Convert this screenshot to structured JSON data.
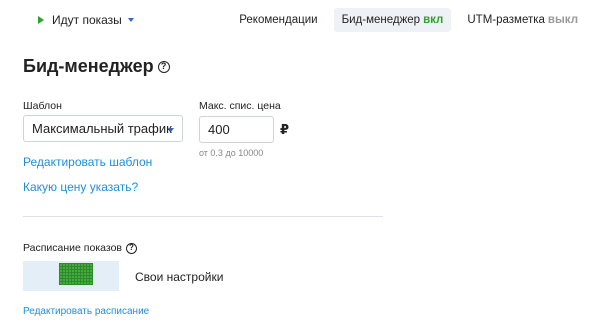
{
  "topbar": {
    "status_label": "Идут показы",
    "tabs": [
      {
        "label": "Рекомендации",
        "state": ""
      },
      {
        "label": "Бид-менеджер",
        "state": "вкл"
      },
      {
        "label": "UTM-разметка",
        "state": "выкл"
      }
    ]
  },
  "bid_manager": {
    "title": "Бид-менеджер",
    "help_glyph": "?",
    "template_label": "Шаблон",
    "template_value": "Максимальный трафик",
    "max_price_label": "Макс. спис. цена",
    "max_price_value": "400",
    "currency": "₽",
    "price_hint": "от 0.3 до 10000",
    "edit_template_link": "Редактировать шаблон",
    "which_price_link": "Какую цену указать?"
  },
  "schedule": {
    "title": "Расписание показов",
    "help_glyph": "?",
    "preset_label": "Свои настройки",
    "edit_link": "Редактировать расписание"
  },
  "colors": {
    "accent_link": "#1f8fd6",
    "on_green": "#2ea12e",
    "off_gray": "#999999"
  },
  "icons": {
    "status": "play-icon",
    "dropdown": "chevron-down-icon",
    "help": "question-circle-icon"
  }
}
